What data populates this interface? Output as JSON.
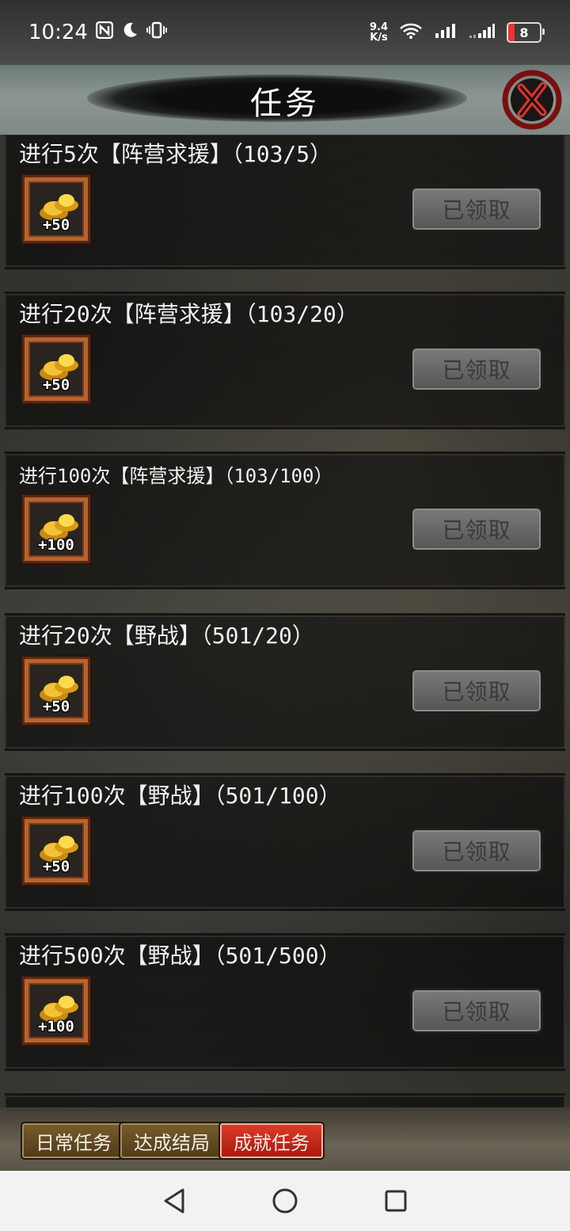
{
  "status_bar": {
    "time": "10:24",
    "net_speed_value": "9.4",
    "net_speed_unit": "K/s",
    "battery": "8",
    "icons": [
      "nfc-icon",
      "moon-icon",
      "vibrate-icon",
      "wifi-icon",
      "signal-icon",
      "signal-icon"
    ]
  },
  "header": {
    "title": "任务",
    "close_icon": "close-x-icon"
  },
  "tasks": [
    {
      "title": "进行5次【阵营求援】（103/5）",
      "reward_icon": "gold-ingot-icon",
      "reward": "+50",
      "button": "已领取"
    },
    {
      "title": "进行20次【阵营求援】（103/20）",
      "reward_icon": "gold-ingot-icon",
      "reward": "+50",
      "button": "已领取"
    },
    {
      "title": "进行100次【阵营求援】（103/100）",
      "reward_icon": "gold-ingot-icon",
      "reward": "+100",
      "button": "已领取"
    },
    {
      "title": "进行20次【野战】（501/20）",
      "reward_icon": "gold-ingot-icon",
      "reward": "+50",
      "button": "已领取"
    },
    {
      "title": "进行100次【野战】（501/100）",
      "reward_icon": "gold-ingot-icon",
      "reward": "+50",
      "button": "已领取"
    },
    {
      "title": "进行500次【野战】（501/500）",
      "reward_icon": "gold-ingot-icon",
      "reward": "+100",
      "button": "已领取"
    }
  ],
  "tabs": [
    {
      "label": "日常任务",
      "active": false
    },
    {
      "label": "达成结局",
      "active": false
    },
    {
      "label": "成就任务",
      "active": true
    }
  ],
  "colors": {
    "active_tab": "#d62a1c",
    "inactive_tab": "#6b4f24",
    "claimed_button": "#6a6a68",
    "reward_frame": "#b8632f"
  },
  "nav": [
    "back-triangle-icon",
    "home-circle-icon",
    "recents-square-icon"
  ]
}
